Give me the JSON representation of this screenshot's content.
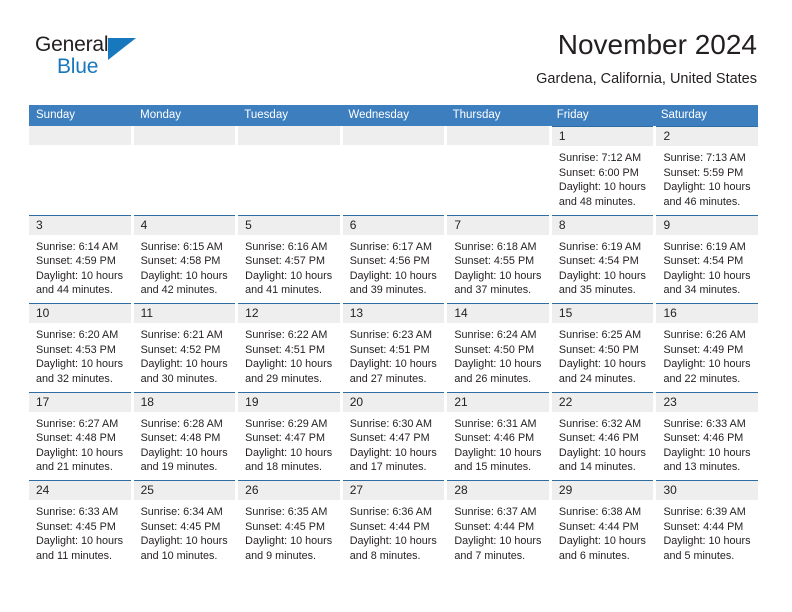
{
  "brand": {
    "name_part1": "General",
    "name_part2": "Blue",
    "triangle_color": "#1878be"
  },
  "header": {
    "title": "November 2024",
    "subtitle": "Gardena, California, United States",
    "header_bg_color": "#3d7ebf",
    "row_border_color": "#2e6da4",
    "day_band_color": "#eeeeee"
  },
  "weekdays": [
    "Sunday",
    "Monday",
    "Tuesday",
    "Wednesday",
    "Thursday",
    "Friday",
    "Saturday"
  ],
  "weeks": [
    [
      {
        "day": "",
        "sunrise": "",
        "sunset": "",
        "daylight_line1": "",
        "daylight_line2": "",
        "empty": true
      },
      {
        "day": "",
        "sunrise": "",
        "sunset": "",
        "daylight_line1": "",
        "daylight_line2": "",
        "empty": true
      },
      {
        "day": "",
        "sunrise": "",
        "sunset": "",
        "daylight_line1": "",
        "daylight_line2": "",
        "empty": true
      },
      {
        "day": "",
        "sunrise": "",
        "sunset": "",
        "daylight_line1": "",
        "daylight_line2": "",
        "empty": true
      },
      {
        "day": "",
        "sunrise": "",
        "sunset": "",
        "daylight_line1": "",
        "daylight_line2": "",
        "empty": true
      },
      {
        "day": "1",
        "sunrise": "Sunrise: 7:12 AM",
        "sunset": "Sunset: 6:00 PM",
        "daylight_line1": "Daylight: 10 hours",
        "daylight_line2": "and 48 minutes.",
        "empty": false
      },
      {
        "day": "2",
        "sunrise": "Sunrise: 7:13 AM",
        "sunset": "Sunset: 5:59 PM",
        "daylight_line1": "Daylight: 10 hours",
        "daylight_line2": "and 46 minutes.",
        "empty": false
      }
    ],
    [
      {
        "day": "3",
        "sunrise": "Sunrise: 6:14 AM",
        "sunset": "Sunset: 4:59 PM",
        "daylight_line1": "Daylight: 10 hours",
        "daylight_line2": "and 44 minutes.",
        "empty": false
      },
      {
        "day": "4",
        "sunrise": "Sunrise: 6:15 AM",
        "sunset": "Sunset: 4:58 PM",
        "daylight_line1": "Daylight: 10 hours",
        "daylight_line2": "and 42 minutes.",
        "empty": false
      },
      {
        "day": "5",
        "sunrise": "Sunrise: 6:16 AM",
        "sunset": "Sunset: 4:57 PM",
        "daylight_line1": "Daylight: 10 hours",
        "daylight_line2": "and 41 minutes.",
        "empty": false
      },
      {
        "day": "6",
        "sunrise": "Sunrise: 6:17 AM",
        "sunset": "Sunset: 4:56 PM",
        "daylight_line1": "Daylight: 10 hours",
        "daylight_line2": "and 39 minutes.",
        "empty": false
      },
      {
        "day": "7",
        "sunrise": "Sunrise: 6:18 AM",
        "sunset": "Sunset: 4:55 PM",
        "daylight_line1": "Daylight: 10 hours",
        "daylight_line2": "and 37 minutes.",
        "empty": false
      },
      {
        "day": "8",
        "sunrise": "Sunrise: 6:19 AM",
        "sunset": "Sunset: 4:54 PM",
        "daylight_line1": "Daylight: 10 hours",
        "daylight_line2": "and 35 minutes.",
        "empty": false
      },
      {
        "day": "9",
        "sunrise": "Sunrise: 6:19 AM",
        "sunset": "Sunset: 4:54 PM",
        "daylight_line1": "Daylight: 10 hours",
        "daylight_line2": "and 34 minutes.",
        "empty": false
      }
    ],
    [
      {
        "day": "10",
        "sunrise": "Sunrise: 6:20 AM",
        "sunset": "Sunset: 4:53 PM",
        "daylight_line1": "Daylight: 10 hours",
        "daylight_line2": "and 32 minutes.",
        "empty": false
      },
      {
        "day": "11",
        "sunrise": "Sunrise: 6:21 AM",
        "sunset": "Sunset: 4:52 PM",
        "daylight_line1": "Daylight: 10 hours",
        "daylight_line2": "and 30 minutes.",
        "empty": false
      },
      {
        "day": "12",
        "sunrise": "Sunrise: 6:22 AM",
        "sunset": "Sunset: 4:51 PM",
        "daylight_line1": "Daylight: 10 hours",
        "daylight_line2": "and 29 minutes.",
        "empty": false
      },
      {
        "day": "13",
        "sunrise": "Sunrise: 6:23 AM",
        "sunset": "Sunset: 4:51 PM",
        "daylight_line1": "Daylight: 10 hours",
        "daylight_line2": "and 27 minutes.",
        "empty": false
      },
      {
        "day": "14",
        "sunrise": "Sunrise: 6:24 AM",
        "sunset": "Sunset: 4:50 PM",
        "daylight_line1": "Daylight: 10 hours",
        "daylight_line2": "and 26 minutes.",
        "empty": false
      },
      {
        "day": "15",
        "sunrise": "Sunrise: 6:25 AM",
        "sunset": "Sunset: 4:50 PM",
        "daylight_line1": "Daylight: 10 hours",
        "daylight_line2": "and 24 minutes.",
        "empty": false
      },
      {
        "day": "16",
        "sunrise": "Sunrise: 6:26 AM",
        "sunset": "Sunset: 4:49 PM",
        "daylight_line1": "Daylight: 10 hours",
        "daylight_line2": "and 22 minutes.",
        "empty": false
      }
    ],
    [
      {
        "day": "17",
        "sunrise": "Sunrise: 6:27 AM",
        "sunset": "Sunset: 4:48 PM",
        "daylight_line1": "Daylight: 10 hours",
        "daylight_line2": "and 21 minutes.",
        "empty": false
      },
      {
        "day": "18",
        "sunrise": "Sunrise: 6:28 AM",
        "sunset": "Sunset: 4:48 PM",
        "daylight_line1": "Daylight: 10 hours",
        "daylight_line2": "and 19 minutes.",
        "empty": false
      },
      {
        "day": "19",
        "sunrise": "Sunrise: 6:29 AM",
        "sunset": "Sunset: 4:47 PM",
        "daylight_line1": "Daylight: 10 hours",
        "daylight_line2": "and 18 minutes.",
        "empty": false
      },
      {
        "day": "20",
        "sunrise": "Sunrise: 6:30 AM",
        "sunset": "Sunset: 4:47 PM",
        "daylight_line1": "Daylight: 10 hours",
        "daylight_line2": "and 17 minutes.",
        "empty": false
      },
      {
        "day": "21",
        "sunrise": "Sunrise: 6:31 AM",
        "sunset": "Sunset: 4:46 PM",
        "daylight_line1": "Daylight: 10 hours",
        "daylight_line2": "and 15 minutes.",
        "empty": false
      },
      {
        "day": "22",
        "sunrise": "Sunrise: 6:32 AM",
        "sunset": "Sunset: 4:46 PM",
        "daylight_line1": "Daylight: 10 hours",
        "daylight_line2": "and 14 minutes.",
        "empty": false
      },
      {
        "day": "23",
        "sunrise": "Sunrise: 6:33 AM",
        "sunset": "Sunset: 4:46 PM",
        "daylight_line1": "Daylight: 10 hours",
        "daylight_line2": "and 13 minutes.",
        "empty": false
      }
    ],
    [
      {
        "day": "24",
        "sunrise": "Sunrise: 6:33 AM",
        "sunset": "Sunset: 4:45 PM",
        "daylight_line1": "Daylight: 10 hours",
        "daylight_line2": "and 11 minutes.",
        "empty": false
      },
      {
        "day": "25",
        "sunrise": "Sunrise: 6:34 AM",
        "sunset": "Sunset: 4:45 PM",
        "daylight_line1": "Daylight: 10 hours",
        "daylight_line2": "and 10 minutes.",
        "empty": false
      },
      {
        "day": "26",
        "sunrise": "Sunrise: 6:35 AM",
        "sunset": "Sunset: 4:45 PM",
        "daylight_line1": "Daylight: 10 hours",
        "daylight_line2": "and 9 minutes.",
        "empty": false
      },
      {
        "day": "27",
        "sunrise": "Sunrise: 6:36 AM",
        "sunset": "Sunset: 4:44 PM",
        "daylight_line1": "Daylight: 10 hours",
        "daylight_line2": "and 8 minutes.",
        "empty": false
      },
      {
        "day": "28",
        "sunrise": "Sunrise: 6:37 AM",
        "sunset": "Sunset: 4:44 PM",
        "daylight_line1": "Daylight: 10 hours",
        "daylight_line2": "and 7 minutes.",
        "empty": false
      },
      {
        "day": "29",
        "sunrise": "Sunrise: 6:38 AM",
        "sunset": "Sunset: 4:44 PM",
        "daylight_line1": "Daylight: 10 hours",
        "daylight_line2": "and 6 minutes.",
        "empty": false
      },
      {
        "day": "30",
        "sunrise": "Sunrise: 6:39 AM",
        "sunset": "Sunset: 4:44 PM",
        "daylight_line1": "Daylight: 10 hours",
        "daylight_line2": "and 5 minutes.",
        "empty": false
      }
    ]
  ]
}
